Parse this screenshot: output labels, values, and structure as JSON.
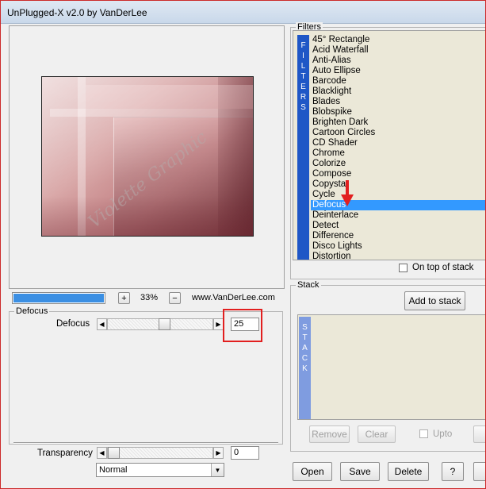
{
  "window": {
    "title": "UnPlugged-X v2.0 by VanDerLee"
  },
  "preview": {
    "watermark": "Violette Graphic",
    "zoom_label": "33%",
    "zoom_plus": "+",
    "zoom_minus": "−",
    "website": "www.VanDerLee.com",
    "progress_percent": 100
  },
  "params": {
    "group_title": "Defocus",
    "slider_label": "Defocus",
    "slider_value": "25",
    "slider_fraction": 0.55
  },
  "transparency": {
    "label": "Transparency",
    "value": "0",
    "slider_fraction": 0.0,
    "blend_mode": "Normal"
  },
  "filters": {
    "group_title": "Filters",
    "vertical_label": [
      "F",
      "I",
      "L",
      "T",
      "E",
      "R",
      "S"
    ],
    "items": [
      "45° Rectangle",
      "Acid Waterfall",
      "Anti-Alias",
      "Auto Ellipse",
      "Barcode",
      "Blacklight",
      "Blades",
      "Blobspike",
      "Brighten Dark",
      "Cartoon Circles",
      "CD Shader",
      "Chrome",
      "Colorize",
      "Compose",
      "Copystar",
      "Cycle",
      "Defocus",
      "Deinterlace",
      "Detect",
      "Difference",
      "Disco Lights",
      "Distortion"
    ],
    "selected_index": 16,
    "on_top_label": "On top of stack"
  },
  "stack": {
    "group_title": "Stack",
    "vertical_label": [
      "S",
      "T",
      "A",
      "C",
      "K"
    ],
    "add_button": "Add to stack",
    "remove_button": "Remove",
    "clear_button": "Clear",
    "upto_label": "Upto"
  },
  "footer": {
    "open": "Open",
    "save": "Save",
    "delete": "Delete",
    "help": "?"
  },
  "colors": {
    "selection": "#3399ff",
    "strip_active": "#1f57c6",
    "strip_inactive": "#7f9ce0",
    "highlight": "#e21f1f"
  }
}
